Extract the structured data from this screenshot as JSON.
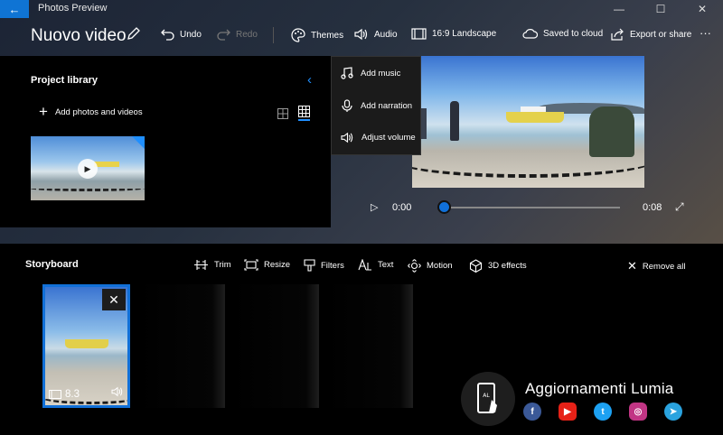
{
  "titlebar": {
    "app_title": "Photos Preview",
    "back_icon": "back-arrow-icon",
    "minimize": "—",
    "maximize": "☐",
    "close": "✕"
  },
  "toolbar": {
    "video_title": "Nuovo video",
    "undo_label": "Undo",
    "redo_label": "Redo",
    "themes_label": "Themes",
    "audio_label": "Audio",
    "aspect_label": "16:9 Landscape",
    "saved_label": "Saved to cloud",
    "export_label": "Export or share",
    "more_label": "···"
  },
  "library": {
    "title": "Project library",
    "add_label": "Add photos and videos"
  },
  "audio_menu": {
    "items": [
      {
        "label": "Add music",
        "icon": "music-note-icon"
      },
      {
        "label": "Add narration",
        "icon": "microphone-icon"
      },
      {
        "label": "Adjust volume",
        "icon": "speaker-icon"
      }
    ]
  },
  "player": {
    "current_time": "0:00",
    "total_time": "0:08",
    "progress": 0.0
  },
  "storyboard": {
    "title": "Storyboard",
    "tools": [
      {
        "label": "Trim",
        "icon": "trim-icon"
      },
      {
        "label": "Resize",
        "icon": "resize-icon"
      },
      {
        "label": "Filters",
        "icon": "filters-icon"
      },
      {
        "label": "Text",
        "icon": "text-icon"
      },
      {
        "label": "Motion",
        "icon": "motion-icon"
      },
      {
        "label": "3D effects",
        "icon": "3d-effects-icon"
      }
    ],
    "remove_all_label": "Remove all",
    "clip": {
      "duration": "8.3"
    }
  },
  "watermark": {
    "brand": "Aggiornamenti Lumia",
    "social_colors": {
      "facebook": "#3b5998",
      "youtube": "#e62117",
      "twitter": "#1da1f2",
      "instagram": "#c13584",
      "telegram": "#2aa3df"
    }
  },
  "colors": {
    "accent": "#1170d8",
    "library_bg": "#000000",
    "menu_bg": "#1b1b1b"
  }
}
